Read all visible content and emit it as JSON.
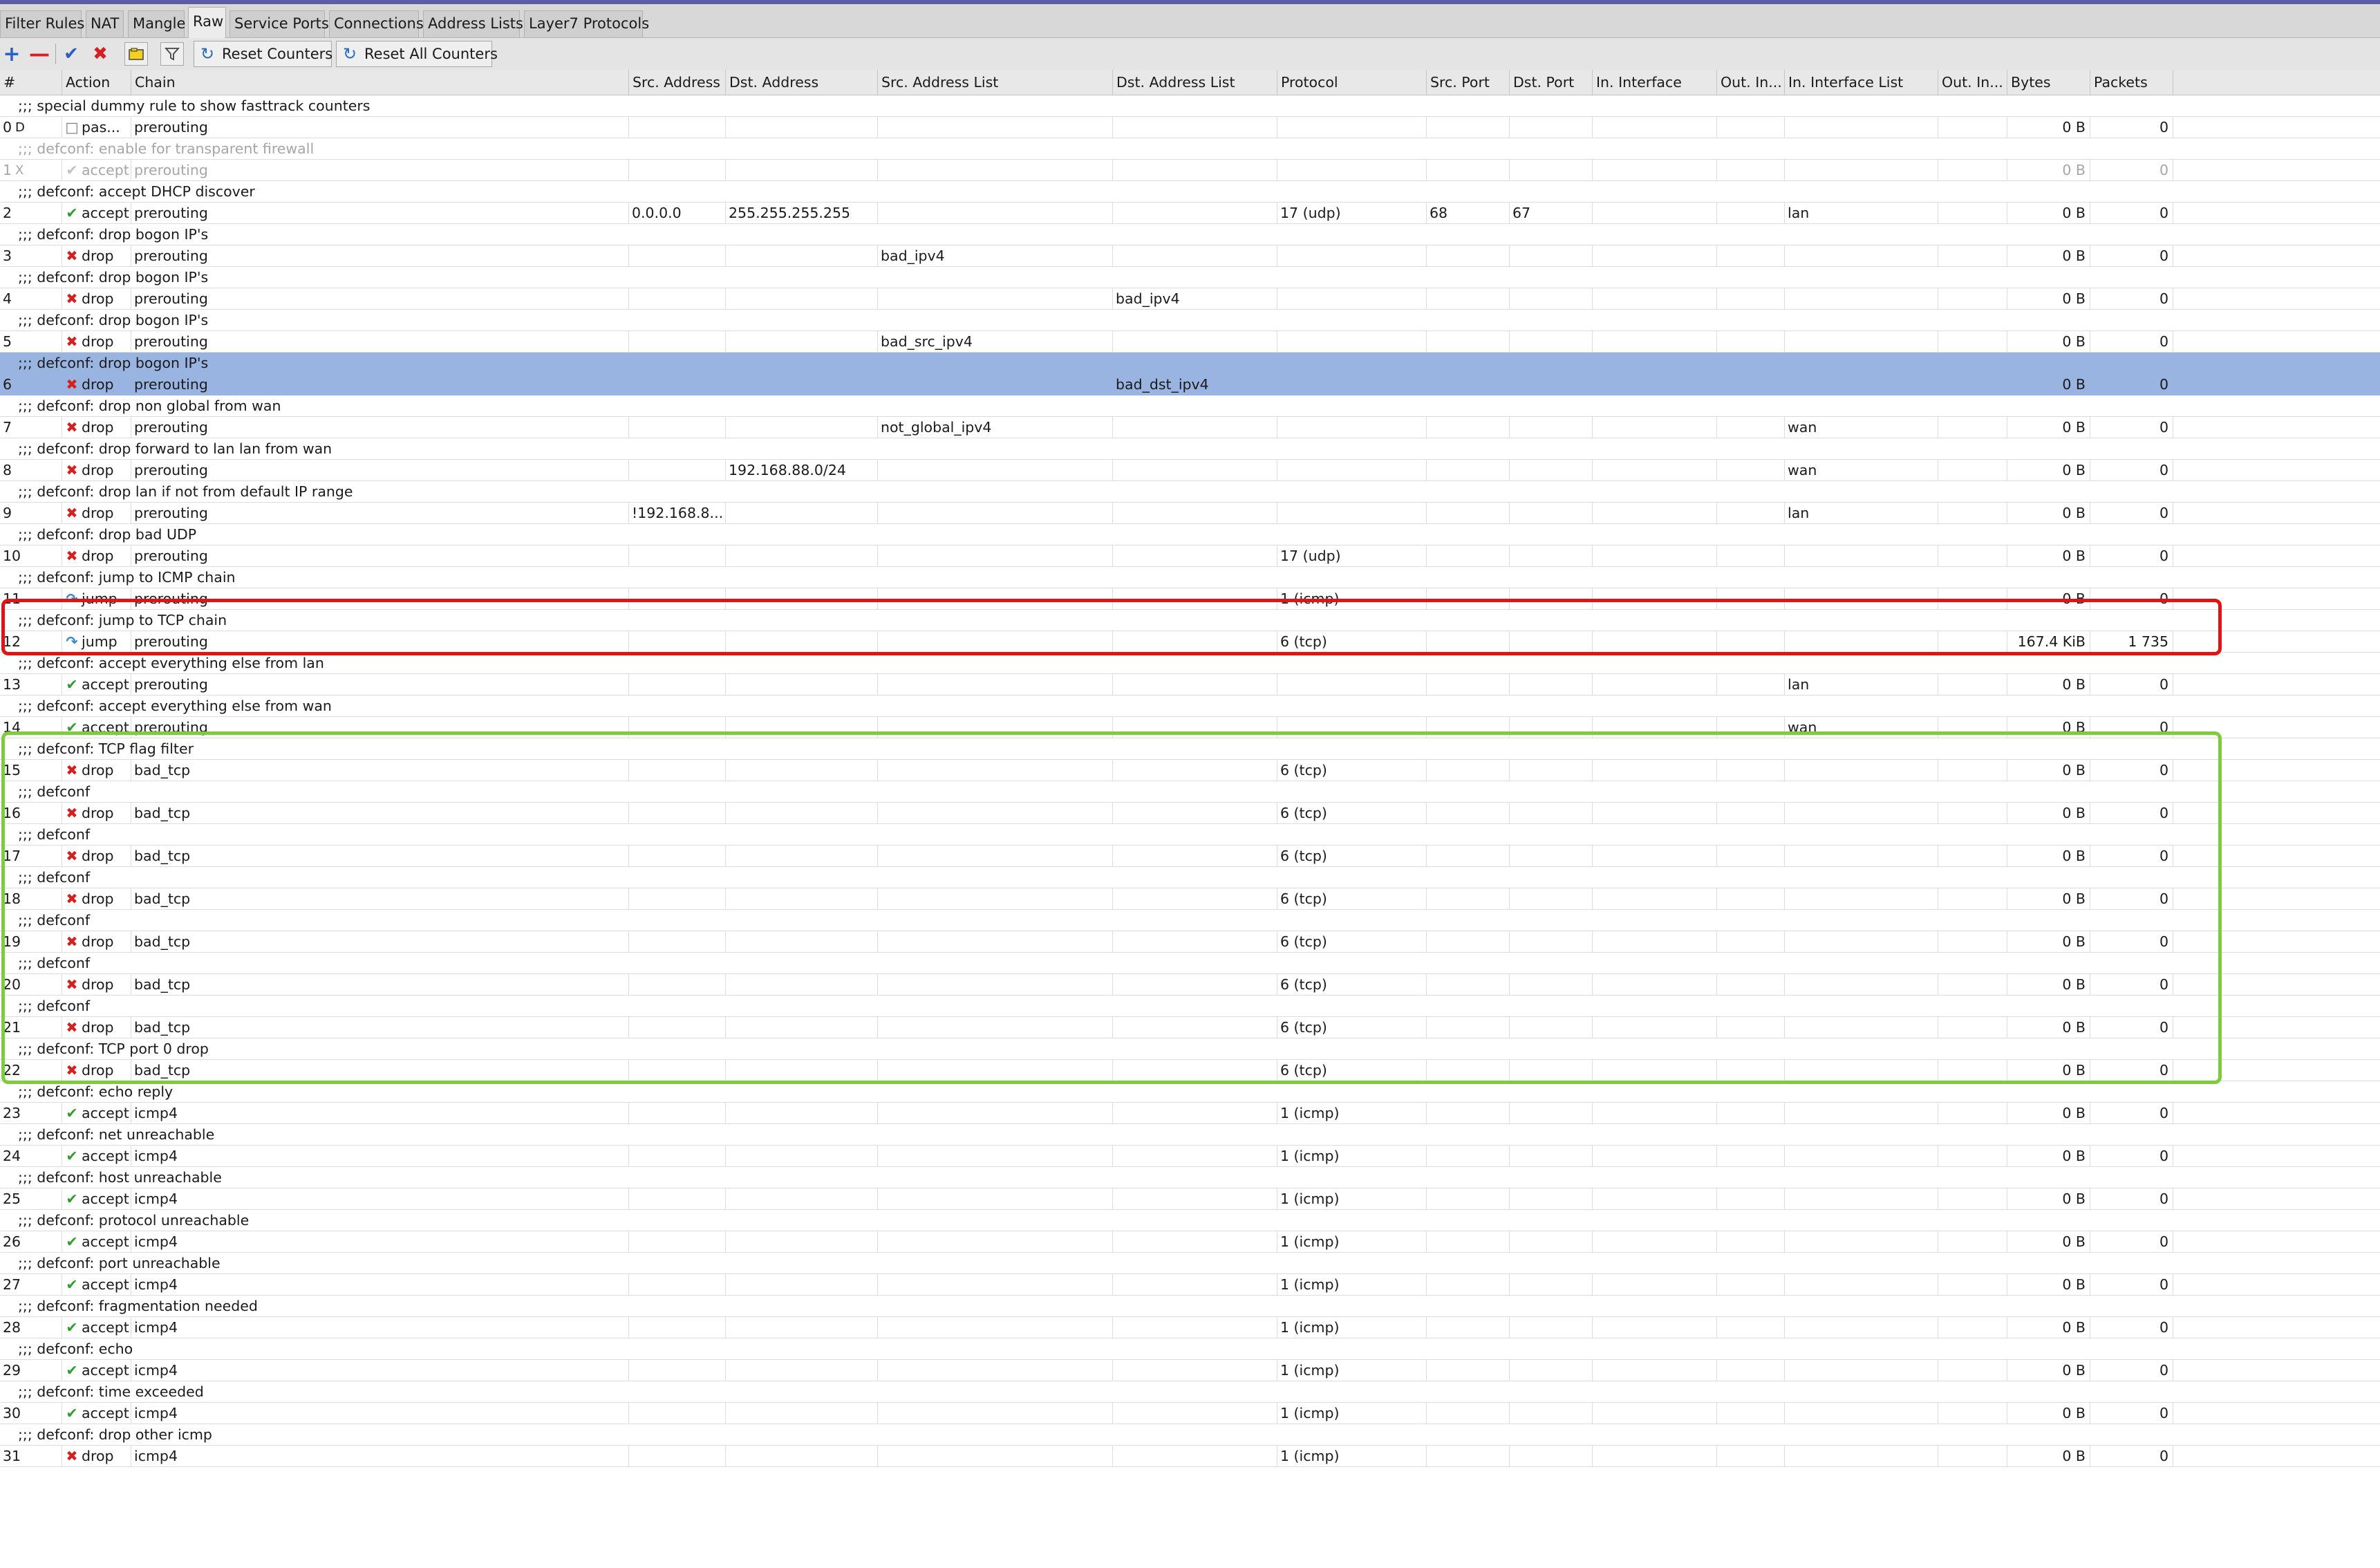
{
  "tabs": [
    {
      "label": "Filter Rules",
      "active": false
    },
    {
      "label": "NAT",
      "active": false
    },
    {
      "label": "Mangle",
      "active": false
    },
    {
      "label": "Raw",
      "active": true
    },
    {
      "label": "Service Ports",
      "active": false
    },
    {
      "label": "Connections",
      "active": false
    },
    {
      "label": "Address Lists",
      "active": false
    },
    {
      "label": "Layer7 Protocols",
      "active": false
    }
  ],
  "toolbar": {
    "add_icon": "plus-icon",
    "remove_icon": "minus-icon",
    "enable_icon": "check-icon",
    "disable_icon": "x-icon",
    "comment_icon": "note-icon",
    "filter_icon": "filter-icon",
    "reset_counters_label": "Reset Counters",
    "reset_all_counters_label": "Reset All Counters"
  },
  "columns": [
    "#",
    "Action",
    "Chain",
    "Src. Address",
    "Dst. Address",
    "Src. Address List",
    "Dst. Address List",
    "Protocol",
    "Src. Port",
    "Dst. Port",
    "In. Interface",
    "Out. In...",
    "In. Interface List",
    "Out. In...",
    "Bytes",
    "Packets"
  ],
  "rows": [
    {
      "type": "comment",
      "text": ";;; special dummy rule to show fasttrack counters"
    },
    {
      "type": "rule",
      "num": "0",
      "flag": "D",
      "action": "pas...",
      "icon": "pass",
      "chain": "prerouting",
      "src": "",
      "dst": "",
      "srclist": "",
      "dstlist": "",
      "proto": "",
      "sport": "",
      "dport": "",
      "inif": "",
      "outif": "",
      "iniflist": "",
      "outiflist": "",
      "bytes": "0 B",
      "packets": "0"
    },
    {
      "type": "comment",
      "text": ";;; defconf: enable for transparent firewall",
      "disabled": true
    },
    {
      "type": "rule",
      "num": "1",
      "flag": "X",
      "action": "accept",
      "icon": "accept-dis",
      "chain": "prerouting",
      "src": "",
      "dst": "",
      "srclist": "",
      "dstlist": "",
      "proto": "",
      "sport": "",
      "dport": "",
      "inif": "",
      "outif": "",
      "iniflist": "",
      "outiflist": "",
      "bytes": "0 B",
      "packets": "0",
      "disabled": true
    },
    {
      "type": "comment",
      "text": ";;; defconf: accept DHCP discover"
    },
    {
      "type": "rule",
      "num": "2",
      "flag": "",
      "action": "accept",
      "icon": "accept",
      "chain": "prerouting",
      "src": "0.0.0.0",
      "dst": "255.255.255.255",
      "srclist": "",
      "dstlist": "",
      "proto": "17 (udp)",
      "sport": "68",
      "dport": "67",
      "inif": "",
      "outif": "",
      "iniflist": "lan",
      "outiflist": "",
      "bytes": "0 B",
      "packets": "0"
    },
    {
      "type": "comment",
      "text": ";;; defconf: drop bogon IP's"
    },
    {
      "type": "rule",
      "num": "3",
      "flag": "",
      "action": "drop",
      "icon": "drop",
      "chain": "prerouting",
      "src": "",
      "dst": "",
      "srclist": "bad_ipv4",
      "dstlist": "",
      "proto": "",
      "sport": "",
      "dport": "",
      "inif": "",
      "outif": "",
      "iniflist": "",
      "outiflist": "",
      "bytes": "0 B",
      "packets": "0"
    },
    {
      "type": "comment",
      "text": ";;; defconf: drop bogon IP's"
    },
    {
      "type": "rule",
      "num": "4",
      "flag": "",
      "action": "drop",
      "icon": "drop",
      "chain": "prerouting",
      "src": "",
      "dst": "",
      "srclist": "",
      "dstlist": "bad_ipv4",
      "proto": "",
      "sport": "",
      "dport": "",
      "inif": "",
      "outif": "",
      "iniflist": "",
      "outiflist": "",
      "bytes": "0 B",
      "packets": "0"
    },
    {
      "type": "comment",
      "text": ";;; defconf: drop bogon IP's"
    },
    {
      "type": "rule",
      "num": "5",
      "flag": "",
      "action": "drop",
      "icon": "drop",
      "chain": "prerouting",
      "src": "",
      "dst": "",
      "srclist": "bad_src_ipv4",
      "dstlist": "",
      "proto": "",
      "sport": "",
      "dport": "",
      "inif": "",
      "outif": "",
      "iniflist": "",
      "outiflist": "",
      "bytes": "0 B",
      "packets": "0"
    },
    {
      "type": "comment",
      "text": ";;; defconf: drop bogon IP's",
      "selected": true
    },
    {
      "type": "rule",
      "num": "6",
      "flag": "",
      "action": "drop",
      "icon": "drop",
      "chain": "prerouting",
      "src": "",
      "dst": "",
      "srclist": "",
      "dstlist": "bad_dst_ipv4",
      "proto": "",
      "sport": "",
      "dport": "",
      "inif": "",
      "outif": "",
      "iniflist": "",
      "outiflist": "",
      "bytes": "0 B",
      "packets": "0",
      "selected": true
    },
    {
      "type": "comment",
      "text": ";;; defconf: drop non global from wan"
    },
    {
      "type": "rule",
      "num": "7",
      "flag": "",
      "action": "drop",
      "icon": "drop",
      "chain": "prerouting",
      "src": "",
      "dst": "",
      "srclist": "not_global_ipv4",
      "dstlist": "",
      "proto": "",
      "sport": "",
      "dport": "",
      "inif": "",
      "outif": "",
      "iniflist": "wan",
      "outiflist": "",
      "bytes": "0 B",
      "packets": "0"
    },
    {
      "type": "comment",
      "text": ";;; defconf: drop forward to lan lan from wan"
    },
    {
      "type": "rule",
      "num": "8",
      "flag": "",
      "action": "drop",
      "icon": "drop",
      "chain": "prerouting",
      "src": "",
      "dst": "192.168.88.0/24",
      "srclist": "",
      "dstlist": "",
      "proto": "",
      "sport": "",
      "dport": "",
      "inif": "",
      "outif": "",
      "iniflist": "wan",
      "outiflist": "",
      "bytes": "0 B",
      "packets": "0"
    },
    {
      "type": "comment",
      "text": ";;; defconf: drop lan if not from default IP range"
    },
    {
      "type": "rule",
      "num": "9",
      "flag": "",
      "action": "drop",
      "icon": "drop",
      "chain": "prerouting",
      "src": "!192.168.8...",
      "dst": "",
      "srclist": "",
      "dstlist": "",
      "proto": "",
      "sport": "",
      "dport": "",
      "inif": "",
      "outif": "",
      "iniflist": "lan",
      "outiflist": "",
      "bytes": "0 B",
      "packets": "0"
    },
    {
      "type": "comment",
      "text": ";;; defconf: drop bad UDP"
    },
    {
      "type": "rule",
      "num": "10",
      "flag": "",
      "action": "drop",
      "icon": "drop",
      "chain": "prerouting",
      "src": "",
      "dst": "",
      "srclist": "",
      "dstlist": "",
      "proto": "17 (udp)",
      "sport": "",
      "dport": "",
      "inif": "",
      "outif": "",
      "iniflist": "",
      "outiflist": "",
      "bytes": "0 B",
      "packets": "0"
    },
    {
      "type": "comment",
      "text": ";;; defconf: jump to ICMP chain"
    },
    {
      "type": "rule",
      "num": "11",
      "flag": "",
      "action": "jump",
      "icon": "jump",
      "chain": "prerouting",
      "src": "",
      "dst": "",
      "srclist": "",
      "dstlist": "",
      "proto": "1 (icmp)",
      "sport": "",
      "dport": "",
      "inif": "",
      "outif": "",
      "iniflist": "",
      "outiflist": "",
      "bytes": "0 B",
      "packets": "0"
    },
    {
      "type": "comment",
      "text": ";;; defconf: jump to TCP chain"
    },
    {
      "type": "rule",
      "num": "12",
      "flag": "",
      "action": "jump",
      "icon": "jump",
      "chain": "prerouting",
      "src": "",
      "dst": "",
      "srclist": "",
      "dstlist": "",
      "proto": "6 (tcp)",
      "sport": "",
      "dport": "",
      "inif": "",
      "outif": "",
      "iniflist": "",
      "outiflist": "",
      "bytes": "167.4 KiB",
      "packets": "1 735"
    },
    {
      "type": "comment",
      "text": ";;; defconf: accept everything else from lan"
    },
    {
      "type": "rule",
      "num": "13",
      "flag": "",
      "action": "accept",
      "icon": "accept",
      "chain": "prerouting",
      "src": "",
      "dst": "",
      "srclist": "",
      "dstlist": "",
      "proto": "",
      "sport": "",
      "dport": "",
      "inif": "",
      "outif": "",
      "iniflist": "lan",
      "outiflist": "",
      "bytes": "0 B",
      "packets": "0"
    },
    {
      "type": "comment",
      "text": ";;; defconf: accept everything else from wan"
    },
    {
      "type": "rule",
      "num": "14",
      "flag": "",
      "action": "accept",
      "icon": "accept",
      "chain": "prerouting",
      "src": "",
      "dst": "",
      "srclist": "",
      "dstlist": "",
      "proto": "",
      "sport": "",
      "dport": "",
      "inif": "",
      "outif": "",
      "iniflist": "wan",
      "outiflist": "",
      "bytes": "0 B",
      "packets": "0"
    },
    {
      "type": "comment",
      "text": ";;; defconf: TCP flag filter"
    },
    {
      "type": "rule",
      "num": "15",
      "flag": "",
      "action": "drop",
      "icon": "drop",
      "chain": "bad_tcp",
      "src": "",
      "dst": "",
      "srclist": "",
      "dstlist": "",
      "proto": "6 (tcp)",
      "sport": "",
      "dport": "",
      "inif": "",
      "outif": "",
      "iniflist": "",
      "outiflist": "",
      "bytes": "0 B",
      "packets": "0"
    },
    {
      "type": "comment",
      "text": ";;; defconf"
    },
    {
      "type": "rule",
      "num": "16",
      "flag": "",
      "action": "drop",
      "icon": "drop",
      "chain": "bad_tcp",
      "src": "",
      "dst": "",
      "srclist": "",
      "dstlist": "",
      "proto": "6 (tcp)",
      "sport": "",
      "dport": "",
      "inif": "",
      "outif": "",
      "iniflist": "",
      "outiflist": "",
      "bytes": "0 B",
      "packets": "0"
    },
    {
      "type": "comment",
      "text": ";;; defconf"
    },
    {
      "type": "rule",
      "num": "17",
      "flag": "",
      "action": "drop",
      "icon": "drop",
      "chain": "bad_tcp",
      "src": "",
      "dst": "",
      "srclist": "",
      "dstlist": "",
      "proto": "6 (tcp)",
      "sport": "",
      "dport": "",
      "inif": "",
      "outif": "",
      "iniflist": "",
      "outiflist": "",
      "bytes": "0 B",
      "packets": "0"
    },
    {
      "type": "comment",
      "text": ";;; defconf"
    },
    {
      "type": "rule",
      "num": "18",
      "flag": "",
      "action": "drop",
      "icon": "drop",
      "chain": "bad_tcp",
      "src": "",
      "dst": "",
      "srclist": "",
      "dstlist": "",
      "proto": "6 (tcp)",
      "sport": "",
      "dport": "",
      "inif": "",
      "outif": "",
      "iniflist": "",
      "outiflist": "",
      "bytes": "0 B",
      "packets": "0"
    },
    {
      "type": "comment",
      "text": ";;; defconf"
    },
    {
      "type": "rule",
      "num": "19",
      "flag": "",
      "action": "drop",
      "icon": "drop",
      "chain": "bad_tcp",
      "src": "",
      "dst": "",
      "srclist": "",
      "dstlist": "",
      "proto": "6 (tcp)",
      "sport": "",
      "dport": "",
      "inif": "",
      "outif": "",
      "iniflist": "",
      "outiflist": "",
      "bytes": "0 B",
      "packets": "0"
    },
    {
      "type": "comment",
      "text": ";;; defconf"
    },
    {
      "type": "rule",
      "num": "20",
      "flag": "",
      "action": "drop",
      "icon": "drop",
      "chain": "bad_tcp",
      "src": "",
      "dst": "",
      "srclist": "",
      "dstlist": "",
      "proto": "6 (tcp)",
      "sport": "",
      "dport": "",
      "inif": "",
      "outif": "",
      "iniflist": "",
      "outiflist": "",
      "bytes": "0 B",
      "packets": "0"
    },
    {
      "type": "comment",
      "text": ";;; defconf"
    },
    {
      "type": "rule",
      "num": "21",
      "flag": "",
      "action": "drop",
      "icon": "drop",
      "chain": "bad_tcp",
      "src": "",
      "dst": "",
      "srclist": "",
      "dstlist": "",
      "proto": "6 (tcp)",
      "sport": "",
      "dport": "",
      "inif": "",
      "outif": "",
      "iniflist": "",
      "outiflist": "",
      "bytes": "0 B",
      "packets": "0"
    },
    {
      "type": "comment",
      "text": ";;; defconf: TCP port 0 drop"
    },
    {
      "type": "rule",
      "num": "22",
      "flag": "",
      "action": "drop",
      "icon": "drop",
      "chain": "bad_tcp",
      "src": "",
      "dst": "",
      "srclist": "",
      "dstlist": "",
      "proto": "6 (tcp)",
      "sport": "",
      "dport": "",
      "inif": "",
      "outif": "",
      "iniflist": "",
      "outiflist": "",
      "bytes": "0 B",
      "packets": "0"
    },
    {
      "type": "comment",
      "text": ";;; defconf: echo reply"
    },
    {
      "type": "rule",
      "num": "23",
      "flag": "",
      "action": "accept",
      "icon": "accept",
      "chain": "icmp4",
      "src": "",
      "dst": "",
      "srclist": "",
      "dstlist": "",
      "proto": "1 (icmp)",
      "sport": "",
      "dport": "",
      "inif": "",
      "outif": "",
      "iniflist": "",
      "outiflist": "",
      "bytes": "0 B",
      "packets": "0"
    },
    {
      "type": "comment",
      "text": ";;; defconf: net unreachable"
    },
    {
      "type": "rule",
      "num": "24",
      "flag": "",
      "action": "accept",
      "icon": "accept",
      "chain": "icmp4",
      "src": "",
      "dst": "",
      "srclist": "",
      "dstlist": "",
      "proto": "1 (icmp)",
      "sport": "",
      "dport": "",
      "inif": "",
      "outif": "",
      "iniflist": "",
      "outiflist": "",
      "bytes": "0 B",
      "packets": "0"
    },
    {
      "type": "comment",
      "text": ";;; defconf: host unreachable"
    },
    {
      "type": "rule",
      "num": "25",
      "flag": "",
      "action": "accept",
      "icon": "accept",
      "chain": "icmp4",
      "src": "",
      "dst": "",
      "srclist": "",
      "dstlist": "",
      "proto": "1 (icmp)",
      "sport": "",
      "dport": "",
      "inif": "",
      "outif": "",
      "iniflist": "",
      "outiflist": "",
      "bytes": "0 B",
      "packets": "0"
    },
    {
      "type": "comment",
      "text": ";;; defconf: protocol unreachable"
    },
    {
      "type": "rule",
      "num": "26",
      "flag": "",
      "action": "accept",
      "icon": "accept",
      "chain": "icmp4",
      "src": "",
      "dst": "",
      "srclist": "",
      "dstlist": "",
      "proto": "1 (icmp)",
      "sport": "",
      "dport": "",
      "inif": "",
      "outif": "",
      "iniflist": "",
      "outiflist": "",
      "bytes": "0 B",
      "packets": "0"
    },
    {
      "type": "comment",
      "text": ";;; defconf: port unreachable"
    },
    {
      "type": "rule",
      "num": "27",
      "flag": "",
      "action": "accept",
      "icon": "accept",
      "chain": "icmp4",
      "src": "",
      "dst": "",
      "srclist": "",
      "dstlist": "",
      "proto": "1 (icmp)",
      "sport": "",
      "dport": "",
      "inif": "",
      "outif": "",
      "iniflist": "",
      "outiflist": "",
      "bytes": "0 B",
      "packets": "0"
    },
    {
      "type": "comment",
      "text": ";;; defconf: fragmentation needed"
    },
    {
      "type": "rule",
      "num": "28",
      "flag": "",
      "action": "accept",
      "icon": "accept",
      "chain": "icmp4",
      "src": "",
      "dst": "",
      "srclist": "",
      "dstlist": "",
      "proto": "1 (icmp)",
      "sport": "",
      "dport": "",
      "inif": "",
      "outif": "",
      "iniflist": "",
      "outiflist": "",
      "bytes": "0 B",
      "packets": "0"
    },
    {
      "type": "comment",
      "text": ";;; defconf: echo"
    },
    {
      "type": "rule",
      "num": "29",
      "flag": "",
      "action": "accept",
      "icon": "accept",
      "chain": "icmp4",
      "src": "",
      "dst": "",
      "srclist": "",
      "dstlist": "",
      "proto": "1 (icmp)",
      "sport": "",
      "dport": "",
      "inif": "",
      "outif": "",
      "iniflist": "",
      "outiflist": "",
      "bytes": "0 B",
      "packets": "0"
    },
    {
      "type": "comment",
      "text": ";;; defconf: time exceeded"
    },
    {
      "type": "rule",
      "num": "30",
      "flag": "",
      "action": "accept",
      "icon": "accept",
      "chain": "icmp4",
      "src": "",
      "dst": "",
      "srclist": "",
      "dstlist": "",
      "proto": "1 (icmp)",
      "sport": "",
      "dport": "",
      "inif": "",
      "outif": "",
      "iniflist": "",
      "outiflist": "",
      "bytes": "0 B",
      "packets": "0"
    },
    {
      "type": "comment",
      "text": ";;; defconf: drop other icmp"
    },
    {
      "type": "rule",
      "num": "31",
      "flag": "",
      "action": "drop",
      "icon": "drop",
      "chain": "icmp4",
      "src": "",
      "dst": "",
      "srclist": "",
      "dstlist": "",
      "proto": "1 (icmp)",
      "sport": "",
      "dport": "",
      "inif": "",
      "outif": "",
      "iniflist": "",
      "outiflist": "",
      "bytes": "0 B",
      "packets": "0"
    }
  ],
  "highlights": {
    "red_color": "#e01414",
    "green_color": "#7ccc3c",
    "selection_color": "#99b4e1"
  }
}
